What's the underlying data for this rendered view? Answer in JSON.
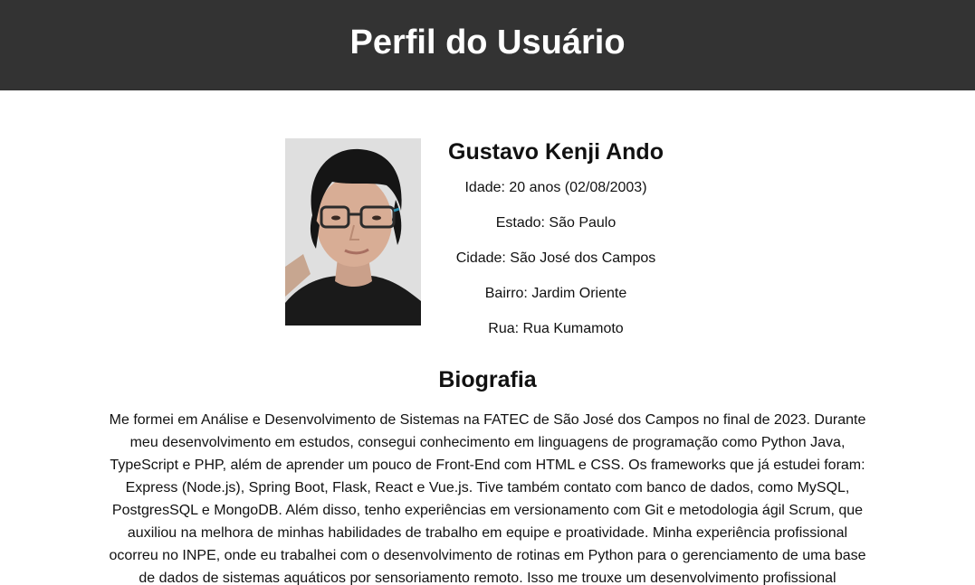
{
  "header": {
    "title": "Perfil do Usuário"
  },
  "profile": {
    "photo_alt": "Foto de perfil",
    "name": "Gustavo Kenji Ando",
    "details": [
      "Idade: 20 anos (02/08/2003)",
      "Estado: São Paulo",
      "Cidade: São José dos Campos",
      "Bairro: Jardim Oriente",
      "Rua: Rua Kumamoto"
    ]
  },
  "bio": {
    "heading": "Biografia",
    "text": "Me formei em Análise e Desenvolvimento de Sistemas na FATEC de São José dos Campos no final de 2023. Durante meu desenvolvimento em estudos, consegui conhecimento em linguagens de programação como Python Java, TypeScript e PHP, além de aprender um pouco de Front-End com HTML e CSS. Os frameworks que já estudei foram: Express (Node.js), Spring Boot, Flask, React e Vue.js. Tive também contato com banco de dados, como MySQL, PostgresSQL e MongoDB. Além disso, tenho experiências em versionamento com Git e metodologia ágil Scrum, que auxiliou na melhora de minhas habilidades de trabalho em equipe e proatividade. Minha experiência profissional ocorreu no INPE, onde eu trabalhei com o desenvolvimento de rotinas em Python para o gerenciamento de uma base de dados de sistemas aquáticos por sensoriamento remoto. Isso me trouxe um desenvolvimento profissional"
  },
  "colors": {
    "header_bg": "#333333",
    "header_text": "#ffffff",
    "page_bg": "#ffffff",
    "text": "#111111"
  }
}
